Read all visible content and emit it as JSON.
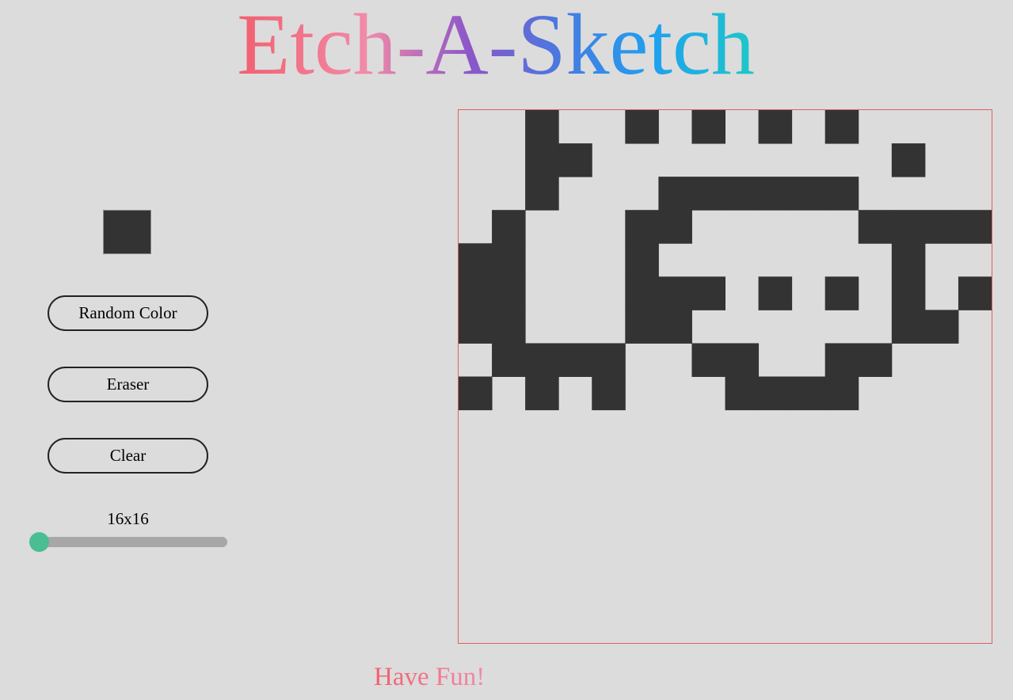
{
  "header": {
    "title": "Etch-A-Sketch"
  },
  "controls": {
    "current_color": "#333333",
    "random_color_label": "Random Color",
    "eraser_label": "Eraser",
    "clear_label": "Clear",
    "grid_size_label": "16x16",
    "grid_size_slider_level": 0
  },
  "board": {
    "grid_size": 16,
    "cell_color": "#333333",
    "background_color": "#dcdcdc",
    "filled_cells": [
      [
        0,
        2
      ],
      [
        0,
        5
      ],
      [
        0,
        7
      ],
      [
        0,
        9
      ],
      [
        0,
        11
      ],
      [
        1,
        2
      ],
      [
        1,
        3
      ],
      [
        1,
        13
      ],
      [
        2,
        2
      ],
      [
        2,
        6
      ],
      [
        2,
        7
      ],
      [
        2,
        8
      ],
      [
        2,
        9
      ],
      [
        2,
        10
      ],
      [
        2,
        11
      ],
      [
        3,
        1
      ],
      [
        3,
        5
      ],
      [
        3,
        6
      ],
      [
        3,
        12
      ],
      [
        3,
        13
      ],
      [
        3,
        14
      ],
      [
        3,
        15
      ],
      [
        4,
        0
      ],
      [
        4,
        1
      ],
      [
        4,
        5
      ],
      [
        4,
        13
      ],
      [
        5,
        0
      ],
      [
        5,
        1
      ],
      [
        5,
        5
      ],
      [
        5,
        6
      ],
      [
        5,
        7
      ],
      [
        5,
        9
      ],
      [
        5,
        11
      ],
      [
        5,
        13
      ],
      [
        5,
        15
      ],
      [
        6,
        0
      ],
      [
        6,
        1
      ],
      [
        6,
        5
      ],
      [
        6,
        6
      ],
      [
        6,
        13
      ],
      [
        6,
        14
      ],
      [
        7,
        1
      ],
      [
        7,
        2
      ],
      [
        7,
        3
      ],
      [
        7,
        4
      ],
      [
        7,
        7
      ],
      [
        7,
        8
      ],
      [
        7,
        11
      ],
      [
        7,
        12
      ],
      [
        8,
        0
      ],
      [
        8,
        2
      ],
      [
        8,
        4
      ],
      [
        8,
        8
      ],
      [
        8,
        9
      ],
      [
        8,
        10
      ],
      [
        8,
        11
      ]
    ]
  },
  "footer": {
    "text": "Have Fun!"
  },
  "colors": {
    "accent_thumb": "#4abd92",
    "board_border": "#e06060"
  }
}
